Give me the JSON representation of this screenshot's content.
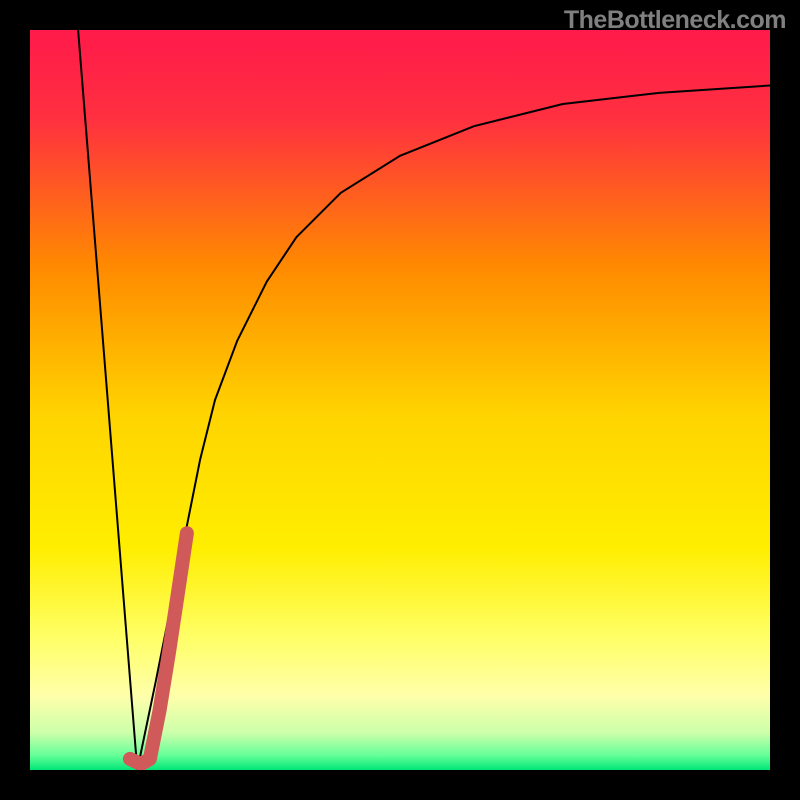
{
  "watermark": "TheBottleneck.com",
  "chart_data": {
    "type": "line",
    "title": "",
    "xlabel": "",
    "ylabel": "",
    "xlim": [
      0,
      100
    ],
    "ylim": [
      0,
      100
    ],
    "background_gradient": {
      "top": "#ff1a4a",
      "upper_mid": "#ff9a00",
      "mid": "#ffe600",
      "lower_mid": "#ffff99",
      "bottom": "#00e676"
    },
    "series": [
      {
        "name": "descending-line",
        "type": "line",
        "color": "#000000",
        "width": 2,
        "x": [
          6.5,
          14.5
        ],
        "y": [
          100,
          0
        ]
      },
      {
        "name": "rising-curve",
        "type": "line",
        "color": "#000000",
        "width": 2,
        "x": [
          14.5,
          17,
          19,
          21,
          23,
          25,
          28,
          32,
          36,
          42,
          50,
          60,
          72,
          85,
          100
        ],
        "y": [
          0,
          12,
          22,
          32,
          42,
          50,
          58,
          66,
          72,
          78,
          83,
          87,
          90,
          91.5,
          92.5
        ]
      },
      {
        "name": "highlight-marker",
        "type": "line",
        "color": "#d05a5a",
        "width": 14,
        "linecap": "round",
        "x": [
          13.5,
          15,
          16.2,
          17.5,
          18.8,
          20,
          21.2
        ],
        "y": [
          1.5,
          0.8,
          1.5,
          8,
          16,
          24,
          32
        ]
      }
    ]
  }
}
